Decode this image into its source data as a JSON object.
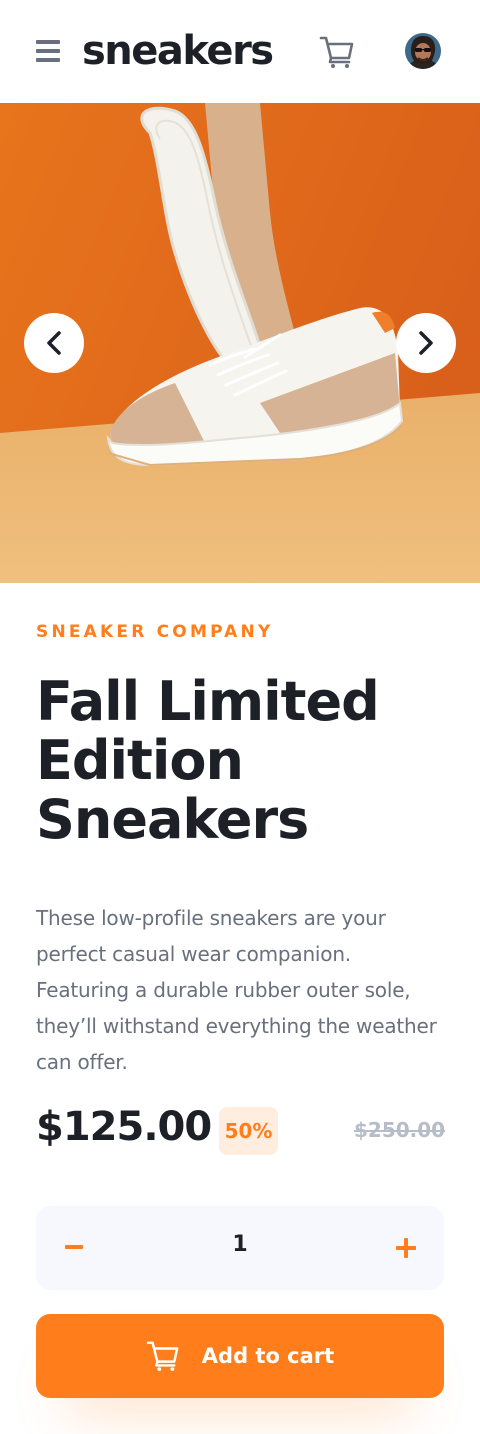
{
  "header": {
    "logo": "sneakers",
    "menu_icon": "hamburger-menu-icon",
    "cart_icon": "cart-icon",
    "avatar_icon": "avatar"
  },
  "carousel": {
    "prev_icon": "chevron-left-icon",
    "next_icon": "chevron-right-icon"
  },
  "product": {
    "company": "SNEAKER COMPANY",
    "title": "Fall Limited Edition Sneakers",
    "description": "These low-profile sneakers are your perfect casual wear companion. Featuring a durable rubber outer sole, they’ll withstand everything the weather can offer.",
    "price": "$125.00",
    "discount": "50%",
    "original_price": "$250.00"
  },
  "quantity": {
    "value": "1",
    "minus_icon": "minus-icon",
    "plus_icon": "plus-icon"
  },
  "actions": {
    "add_to_cart_label": "Add to cart",
    "add_to_cart_icon": "cart-icon"
  },
  "colors": {
    "accent": "#ff7e1b",
    "accent_pale": "#ffede0",
    "text_dark": "#1d2026",
    "text_gray": "#69707d",
    "muted": "#b6bcc8",
    "surface": "#f6f8fd"
  }
}
